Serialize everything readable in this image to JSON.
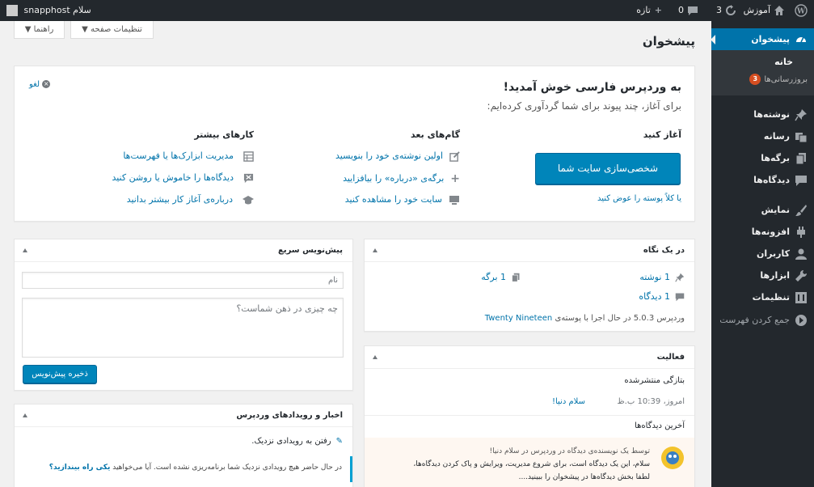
{
  "adminbar": {
    "account": "سلام snapphost",
    "site_name": "آموزش",
    "updates_count": "3",
    "comments_count": "0",
    "new_label": "تازه"
  },
  "sidebar": {
    "dashboard": "پیشخوان",
    "sub_home": "خانه",
    "sub_updates": "بروزرسانی‌ها",
    "sub_updates_badge": "3",
    "posts": "نوشته‌ها",
    "media": "رسانه",
    "pages": "برگه‌ها",
    "comments": "دیدگاه‌ها",
    "appearance": "نمایش",
    "plugins": "افزونه‌ها",
    "users": "کاربران",
    "tools": "ابزارها",
    "settings": "تنظیمات",
    "collapse": "جمع کردن فهرست"
  },
  "screen_options": "تنظیمات صفحه",
  "help": "راهنما",
  "page_title": "پیشخوان",
  "welcome": {
    "title": "به وردپرس فارسی خوش آمدید!",
    "subtitle": "برای آغاز، چند پیوند برای شما گردآوری کرده‌ایم:",
    "dismiss": "لغو",
    "get_started": "آغاز کنید",
    "customize_button": "شخصی‌سازی سایت شما",
    "change_theme": "یا کلاً پوسته را عوض کنید",
    "next_steps": "گام‌های بعد",
    "next": [
      "اولین نوشته‌ی خود را بنویسید",
      "برگه‌ی «درباره» را بیافزایید",
      "سایت خود را مشاهده کنید"
    ],
    "more_actions": "کارهای بیشتر",
    "more": [
      "مدیریت ابزارک‌ها یا فهرست‌ها",
      "دیدگاه‌ها را خاموش یا روشن کنید",
      "درباره‌ی آغاز کار بیشتر بدانید"
    ]
  },
  "glance": {
    "title": "در یک نگاه",
    "posts": "1 نوشته",
    "pages": "1 برگه",
    "comments": "1 دیدگاه",
    "footer_prefix": "وردپرس 5.0.3 در حال اجرا با پوسته‌ی",
    "theme": "Twenty Nineteen"
  },
  "activity": {
    "title": "فعالیت",
    "recently_published": "بتازگی منتشرشده",
    "time": "امروز، 10:39 ب.ظ",
    "post_link": "سلام دنیا!",
    "recent_comments": "آخرین دیدگاه‌ها",
    "comment_author_line": "توسط یک نویسنده‌ی دیدگاه در وردپرس در سلام دنیا!",
    "comment_line1": "سلام، این یک دیدگاه است، برای شروع مدیریت، ویرایش و پاک کردن دیدگاه‌ها،",
    "comment_line2": "لطفا بخش دیدگاه‌ها در پیشخوان را ببینید...."
  },
  "quickdraft": {
    "title": "پیش‌نویس سریع",
    "title_placeholder": "نام",
    "content_placeholder": "چه چیزی در ذهن شماست؟",
    "save": "ذخیره پیش‌نویس"
  },
  "events": {
    "title": "اخبار و رویدادهای وردپرس",
    "attend": "رفتن به رویدادی نزدیک.",
    "none_text": "در حال حاضر هیچ رویدادی نزدیک شما برنامه‌ریزی نشده است. آیا می‌خواهید",
    "organize_link": "یکی راه بیندازید؟"
  },
  "colors": {
    "admin_dark": "#23282d",
    "accent": "#0073aa",
    "button": "#0085ba",
    "badge": "#d54e21"
  }
}
